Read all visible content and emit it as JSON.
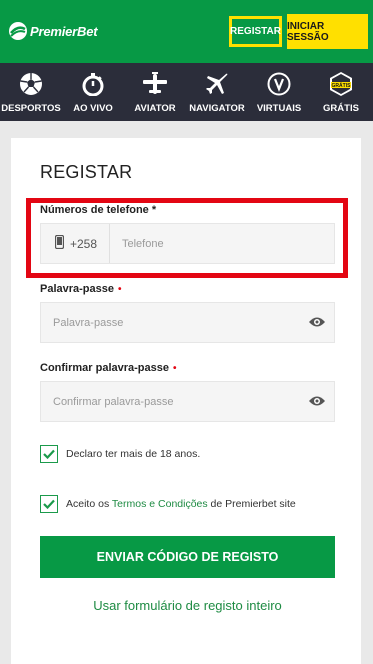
{
  "header": {
    "brand": "PremierBet",
    "register_label": "REGISTAR",
    "login_label": "INICIAR SESSÃO",
    "colors": {
      "brand_green": "#079945",
      "accent_yellow": "#ffe000",
      "nav_bg": "#2b2d3a"
    }
  },
  "nav": {
    "items": [
      {
        "label": "DESPORTOS",
        "icon": "soccer-ball-icon"
      },
      {
        "label": "AO VIVO",
        "icon": "stopwatch-icon"
      },
      {
        "label": "AVIATOR",
        "icon": "airplane-icon"
      },
      {
        "label": "NAVIGATOR",
        "icon": "plane-icon"
      },
      {
        "label": "VIRTUAIS",
        "icon": "v-circle-icon"
      },
      {
        "label": "GRÁTIS",
        "icon": "gratis-badge-icon"
      }
    ],
    "gratis_badge": "GRÁTIS"
  },
  "form": {
    "title": "REGISTAR",
    "phone": {
      "label": "Números de telefone *",
      "prefix": "+258",
      "placeholder": "Telefone",
      "icon": "mobile-phone-icon"
    },
    "password": {
      "label": "Palavra-passe",
      "placeholder": "Palavra-passe",
      "icon": "eye-icon"
    },
    "confirm_password": {
      "label": "Confirmar palavra-passe",
      "placeholder": "Confirmar palavra-passe",
      "icon": "eye-icon"
    },
    "required_mark": "•",
    "age_check": {
      "label": "Declaro ter mais de 18 anos.",
      "checked": true
    },
    "terms_check": {
      "prefix": "Aceito os ",
      "link": "Termos e Condições",
      "suffix": " de Premierbet site",
      "checked": true
    },
    "submit_label": "ENVIAR CÓDIGO DE REGISTO",
    "full_form_link": "Usar formulário de registo inteiro"
  }
}
